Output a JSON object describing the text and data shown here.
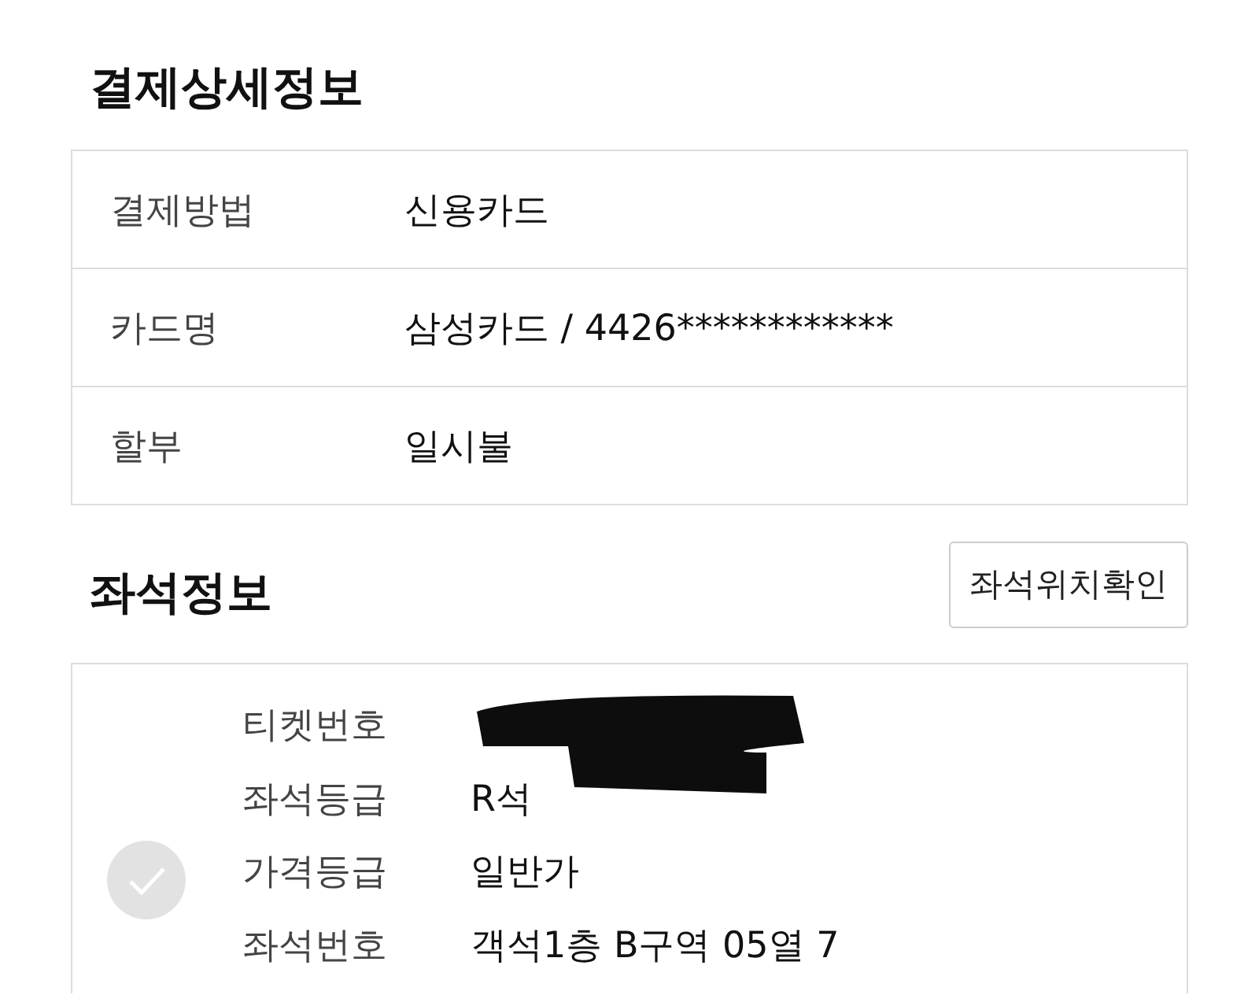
{
  "payment": {
    "title": "결제상세정보",
    "rows": [
      {
        "label": "결제방법",
        "value": "신용카드"
      },
      {
        "label": "카드명",
        "value": "삼성카드 / 4426************"
      },
      {
        "label": "할부",
        "value": "일시불"
      }
    ]
  },
  "seats": {
    "title": "좌석정보",
    "button": "좌석위치확인",
    "selected": false,
    "rows": [
      {
        "label": "티켓번호",
        "kind": "redacted"
      },
      {
        "label": "좌석등급",
        "kind": "text",
        "value": "R석"
      },
      {
        "label": "가격등급",
        "kind": "text",
        "value": "일반가"
      },
      {
        "label": "좌석번호",
        "kind": "text",
        "value": "객석1층 B구역 05열 7"
      }
    ]
  }
}
